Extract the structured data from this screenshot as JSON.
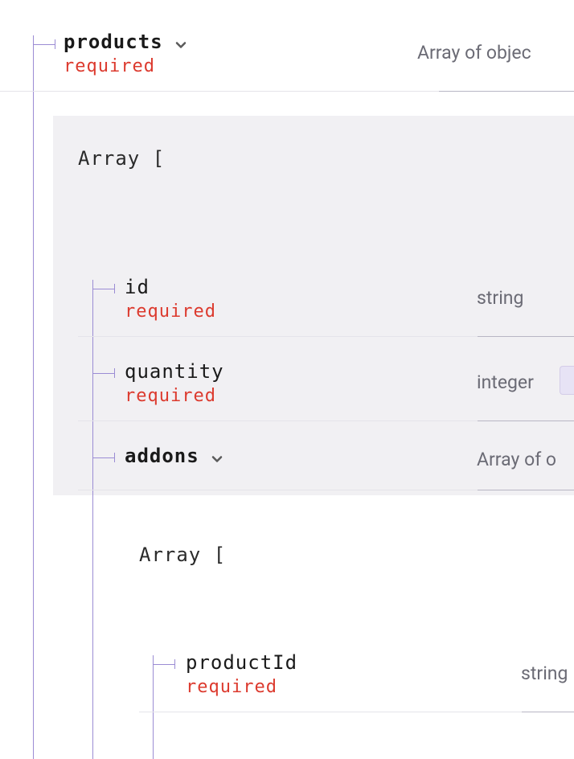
{
  "products": {
    "name": "products",
    "required_label": "required",
    "type_label": "Array of objec",
    "array_open": "Array [",
    "fields": {
      "id": {
        "name": "id",
        "required_label": "required",
        "type_label": "string"
      },
      "quantity": {
        "name": "quantity",
        "required_label": "required",
        "type_label": "integer"
      },
      "addons": {
        "name": "addons",
        "type_label": "Array of o",
        "array_open": "Array [",
        "fields": {
          "productId": {
            "name": "productId",
            "required_label": "required",
            "type_label": "string"
          }
        }
      }
    }
  }
}
